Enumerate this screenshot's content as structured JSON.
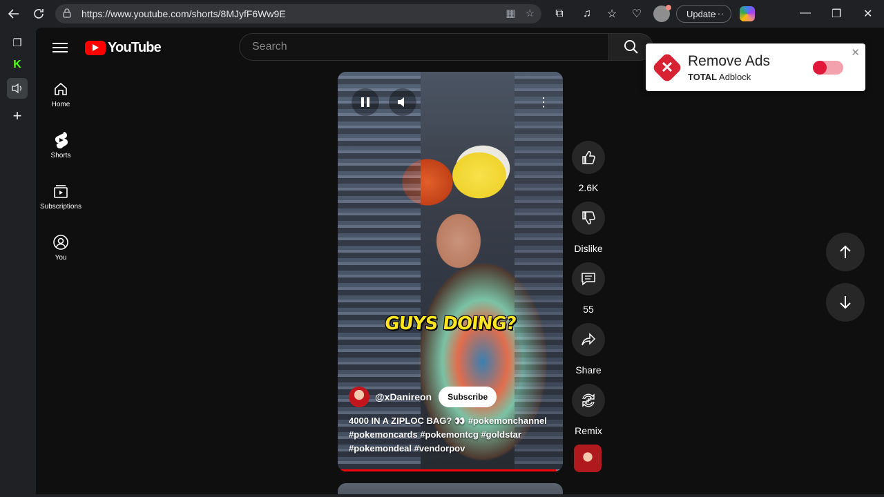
{
  "browser": {
    "url": "https://www.youtube.com/shorts/8MJyfF6Ww9E",
    "update_label": "Update",
    "more_label": "···"
  },
  "youtube": {
    "logo_text": "YouTube",
    "search_placeholder": "Search",
    "nav": [
      {
        "label": "Home"
      },
      {
        "label": "Shorts"
      },
      {
        "label": "Subscriptions"
      },
      {
        "label": "You"
      }
    ]
  },
  "short": {
    "caption_overlay": "GUYS DOING?",
    "channel_handle": "@xDanireon",
    "subscribe_label": "Subscribe",
    "description": "4000 IN A ZIPLOC BAG? 👀 #pokemonchannel #pokemoncards #pokemontcg #goldstar #pokemondeal #vendorpov",
    "progress_fraction": 0.97
  },
  "actions": {
    "like_count": "2.6K",
    "dislike_label": "Dislike",
    "comment_count": "55",
    "share_label": "Share",
    "remix_label": "Remix"
  },
  "adblock_popup": {
    "title": "Remove Ads",
    "brand_bold": "TOTAL",
    "brand_rest": " Adblock",
    "toggle_on": false,
    "accent_color": "#e2183a"
  },
  "colors": {
    "yt_red": "#ff0000",
    "page_bg": "#0f0f0f",
    "chrome_bg": "#202124"
  }
}
